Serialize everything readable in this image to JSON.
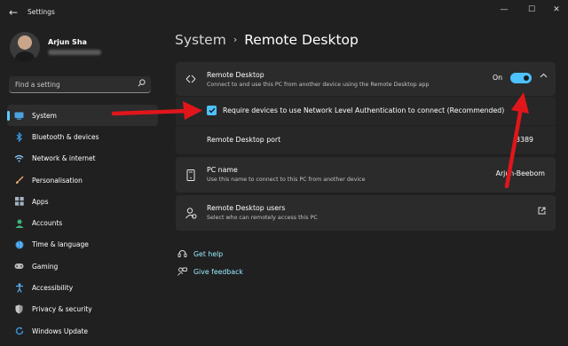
{
  "window": {
    "title": "Settings",
    "back_glyph": "←",
    "controls": {
      "minimize": "—",
      "maximize": "☐",
      "close": "✕"
    }
  },
  "user": {
    "name": "Arjun Sha"
  },
  "search": {
    "placeholder": "Find a setting",
    "icon": "search-icon"
  },
  "sidebar": {
    "items": [
      {
        "label": "System",
        "icon": "system-icon",
        "active": true
      },
      {
        "label": "Bluetooth & devices",
        "icon": "bluetooth-icon"
      },
      {
        "label": "Network & internet",
        "icon": "wifi-icon"
      },
      {
        "label": "Personalisation",
        "icon": "brush-icon"
      },
      {
        "label": "Apps",
        "icon": "apps-icon"
      },
      {
        "label": "Accounts",
        "icon": "person-icon"
      },
      {
        "label": "Time & language",
        "icon": "globe-icon"
      },
      {
        "label": "Gaming",
        "icon": "gamepad-icon"
      },
      {
        "label": "Accessibility",
        "icon": "accessibility-icon"
      },
      {
        "label": "Privacy & security",
        "icon": "shield-icon"
      },
      {
        "label": "Windows Update",
        "icon": "update-icon"
      }
    ]
  },
  "breadcrumb": {
    "root": "System",
    "separator": "›",
    "current": "Remote Desktop"
  },
  "remote_desktop": {
    "title": "Remote Desktop",
    "description": "Connect to and use this PC from another device using the Remote Desktop app",
    "toggle_label": "On",
    "enabled": true,
    "nla_label": "Require devices to use Network Level Authentication to connect (Recommended)",
    "nla_checked": true,
    "port_label": "Remote Desktop port",
    "port_value": "3389"
  },
  "pc_name": {
    "title": "PC name",
    "description": "Use this name to connect to this PC from another device",
    "value": "Arjun-Beebom"
  },
  "users": {
    "title": "Remote Desktop users",
    "description": "Select who can remotely access this PC"
  },
  "links": {
    "help": "Get help",
    "feedback": "Give feedback"
  },
  "colors": {
    "accent": "#4cc2ff",
    "link": "#99ebff",
    "annotation_arrow": "#e0161b",
    "background": "#202020",
    "card": "#2b2b2b"
  }
}
